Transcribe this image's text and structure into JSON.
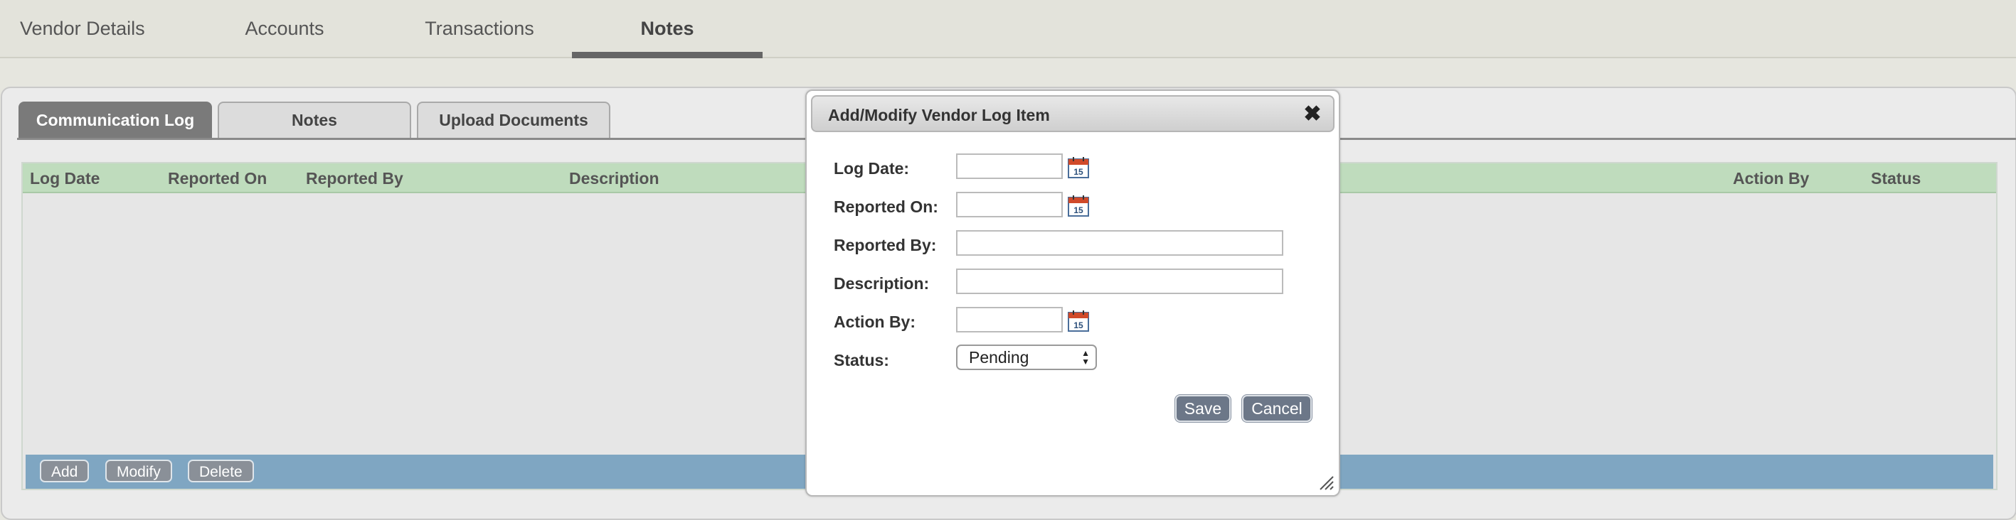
{
  "top_tabs": [
    {
      "label": "Vendor Details",
      "active": false
    },
    {
      "label": "Accounts",
      "active": false
    },
    {
      "label": "Transactions",
      "active": false
    },
    {
      "label": "Notes",
      "active": true
    }
  ],
  "sub_tabs": [
    {
      "label": "Communication Log",
      "active": true
    },
    {
      "label": "Notes",
      "active": false
    },
    {
      "label": "Upload Documents",
      "active": false
    }
  ],
  "grid": {
    "columns": [
      "Log Date",
      "Reported On",
      "Reported By",
      "Description",
      "Action By",
      "Status"
    ],
    "rows": [],
    "buttons": {
      "add": "Add",
      "modify": "Modify",
      "delete": "Delete"
    }
  },
  "modal": {
    "title": "Add/Modify Vendor Log Item",
    "close_icon": "close-icon",
    "fields": {
      "log_date": {
        "label": "Log Date:",
        "value": ""
      },
      "reported_on": {
        "label": "Reported On:",
        "value": ""
      },
      "reported_by": {
        "label": "Reported By:",
        "value": ""
      },
      "description": {
        "label": "Description:",
        "value": ""
      },
      "action_by": {
        "label": "Action By:",
        "value": ""
      },
      "status": {
        "label": "Status:",
        "value": "Pending"
      }
    },
    "calendar_icon_text": "15",
    "buttons": {
      "save": "Save",
      "cancel": "Cancel"
    }
  },
  "colors": {
    "grid_header": "#bfdcbd",
    "grid_footer": "#7fa6c2",
    "active_subtab": "#7a7a7a",
    "modal_button": "#6c7788"
  }
}
